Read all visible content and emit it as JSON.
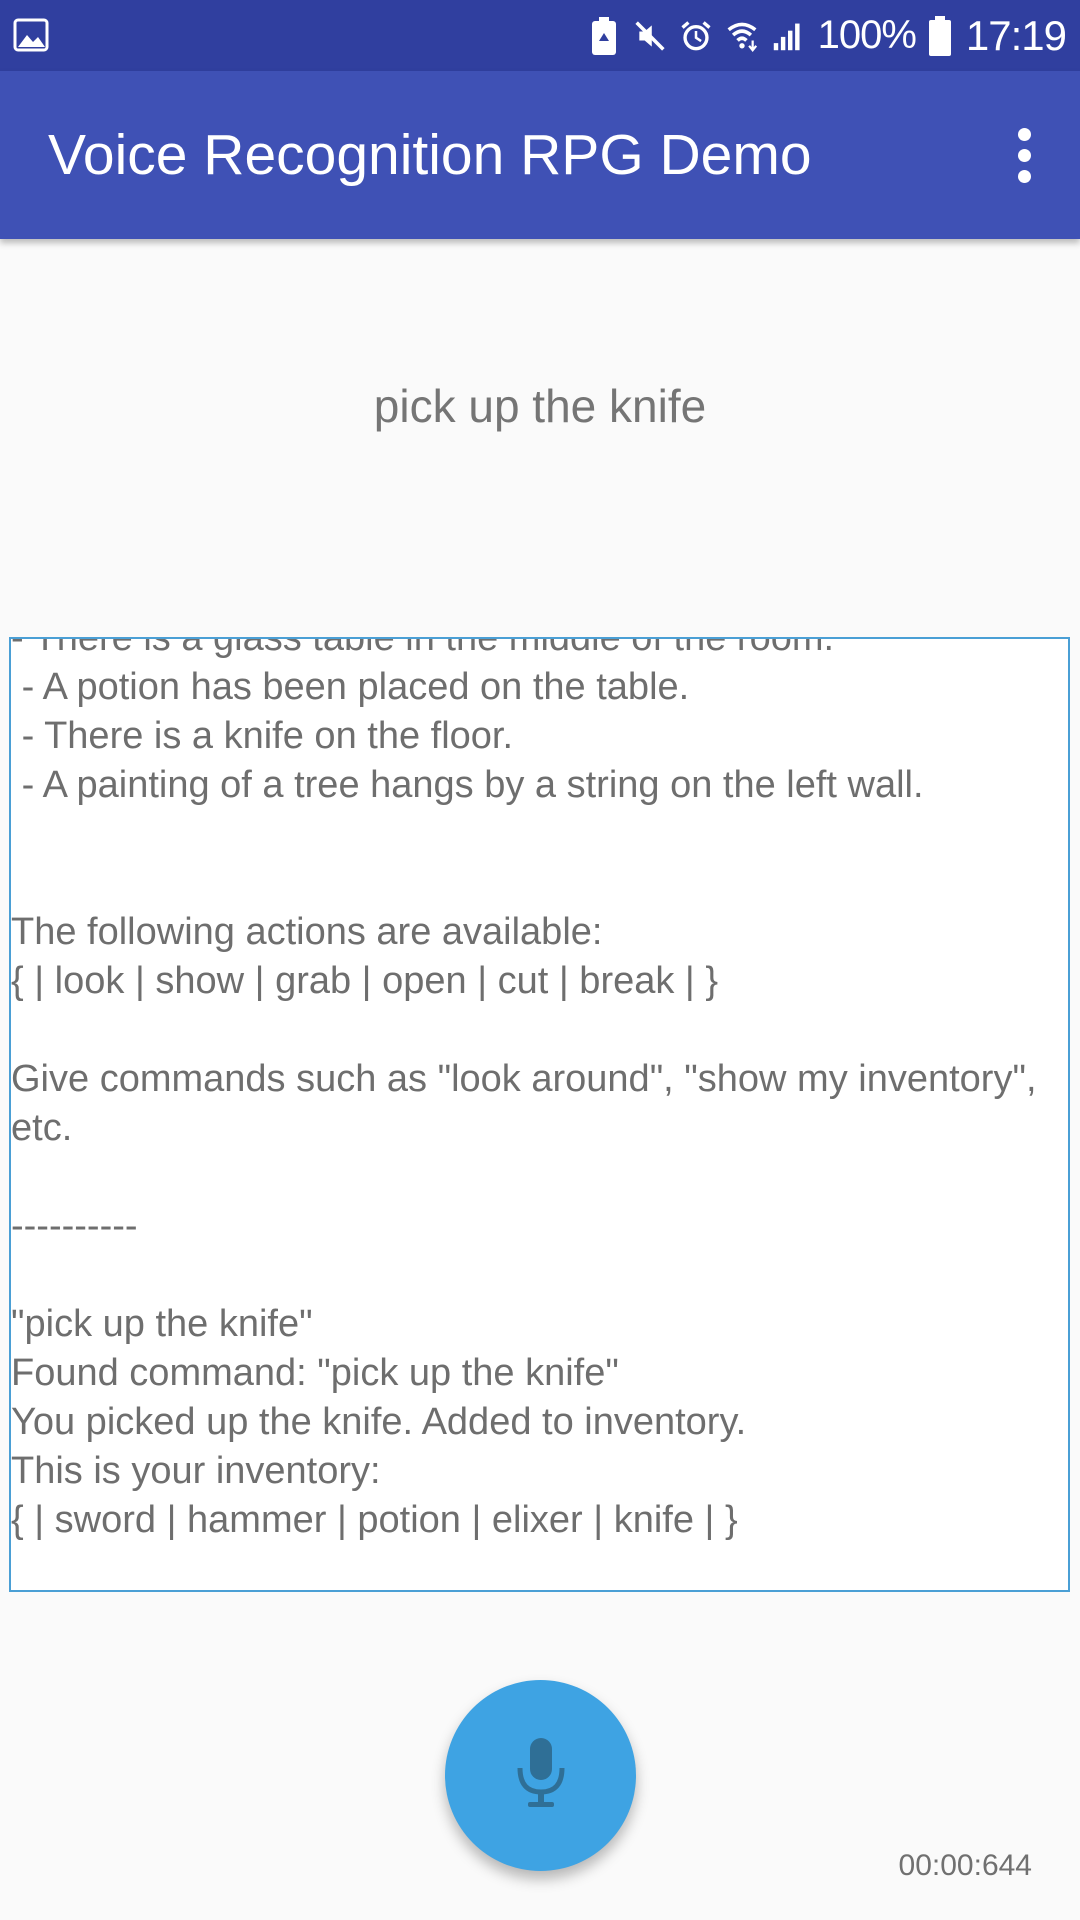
{
  "status_bar": {
    "battery_percent": "100%",
    "time": "17:19",
    "icons": [
      "gallery-icon",
      "recycle-battery-icon",
      "mute-icon",
      "alarm-icon",
      "wifi-icon",
      "signal-icon",
      "battery-icon"
    ]
  },
  "app_bar": {
    "title": "Voice Recognition RPG Demo",
    "menu_icon": "overflow-menu-icon"
  },
  "recognized_phrase": "pick up the knife",
  "game_log": {
    "text": "- There is a glass table in the middle of the room.\n - A potion has been placed on the table.\n - There is a knife on the floor.\n - A painting of a tree hangs by a string on the left wall.\n\n\nThe following actions are available:\n{ | look | show | grab | open | cut | break | }\n\nGive commands such as \"look around\", \"show my inventory\", etc.\n\n----------\n\n\"pick up the knife\"\nFound command: \"pick up the knife\"\nYou picked up the knife. Added to inventory.\nThis is your inventory:\n{ | sword | hammer | potion | elixer | knife | }"
  },
  "mic_button": {
    "icon": "microphone-icon"
  },
  "timer": "00:00:644",
  "colors": {
    "status_bar": "#303f9f",
    "app_bar": "#3f51b5",
    "fab": "#3ea3e3",
    "log_border": "#4a9fd5"
  }
}
